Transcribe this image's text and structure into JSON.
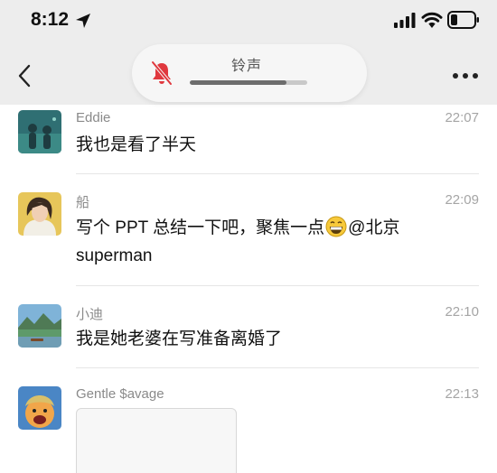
{
  "status_bar": {
    "time": "8:12",
    "icons": [
      "location-arrow-icon",
      "cellular-signal-icon",
      "wifi-icon",
      "battery-low-icon"
    ]
  },
  "nav": {
    "back_icon": "chevron-left-icon",
    "more_icon": "more-dots-icon"
  },
  "ringer": {
    "label": "铃声",
    "icon": "bell-muted-icon",
    "level_percent": 82,
    "accent": "#e0383e"
  },
  "messages": [
    {
      "sender": "Eddie",
      "time": "22:07",
      "text": "我也是看了半天"
    },
    {
      "sender": "船",
      "time": "22:09",
      "text_before_emoji": "写个 PPT 总结一下吧，聚焦一点",
      "emoji": "grinning-face-emoji",
      "text_after_emoji": "@北京",
      "text_line2": "superman"
    },
    {
      "sender": "小迪",
      "time": "22:10",
      "text": "我是她老婆在写准备离婚了"
    },
    {
      "sender": "Gentle $avage",
      "time": "22:13",
      "attachment": "image-card"
    }
  ]
}
